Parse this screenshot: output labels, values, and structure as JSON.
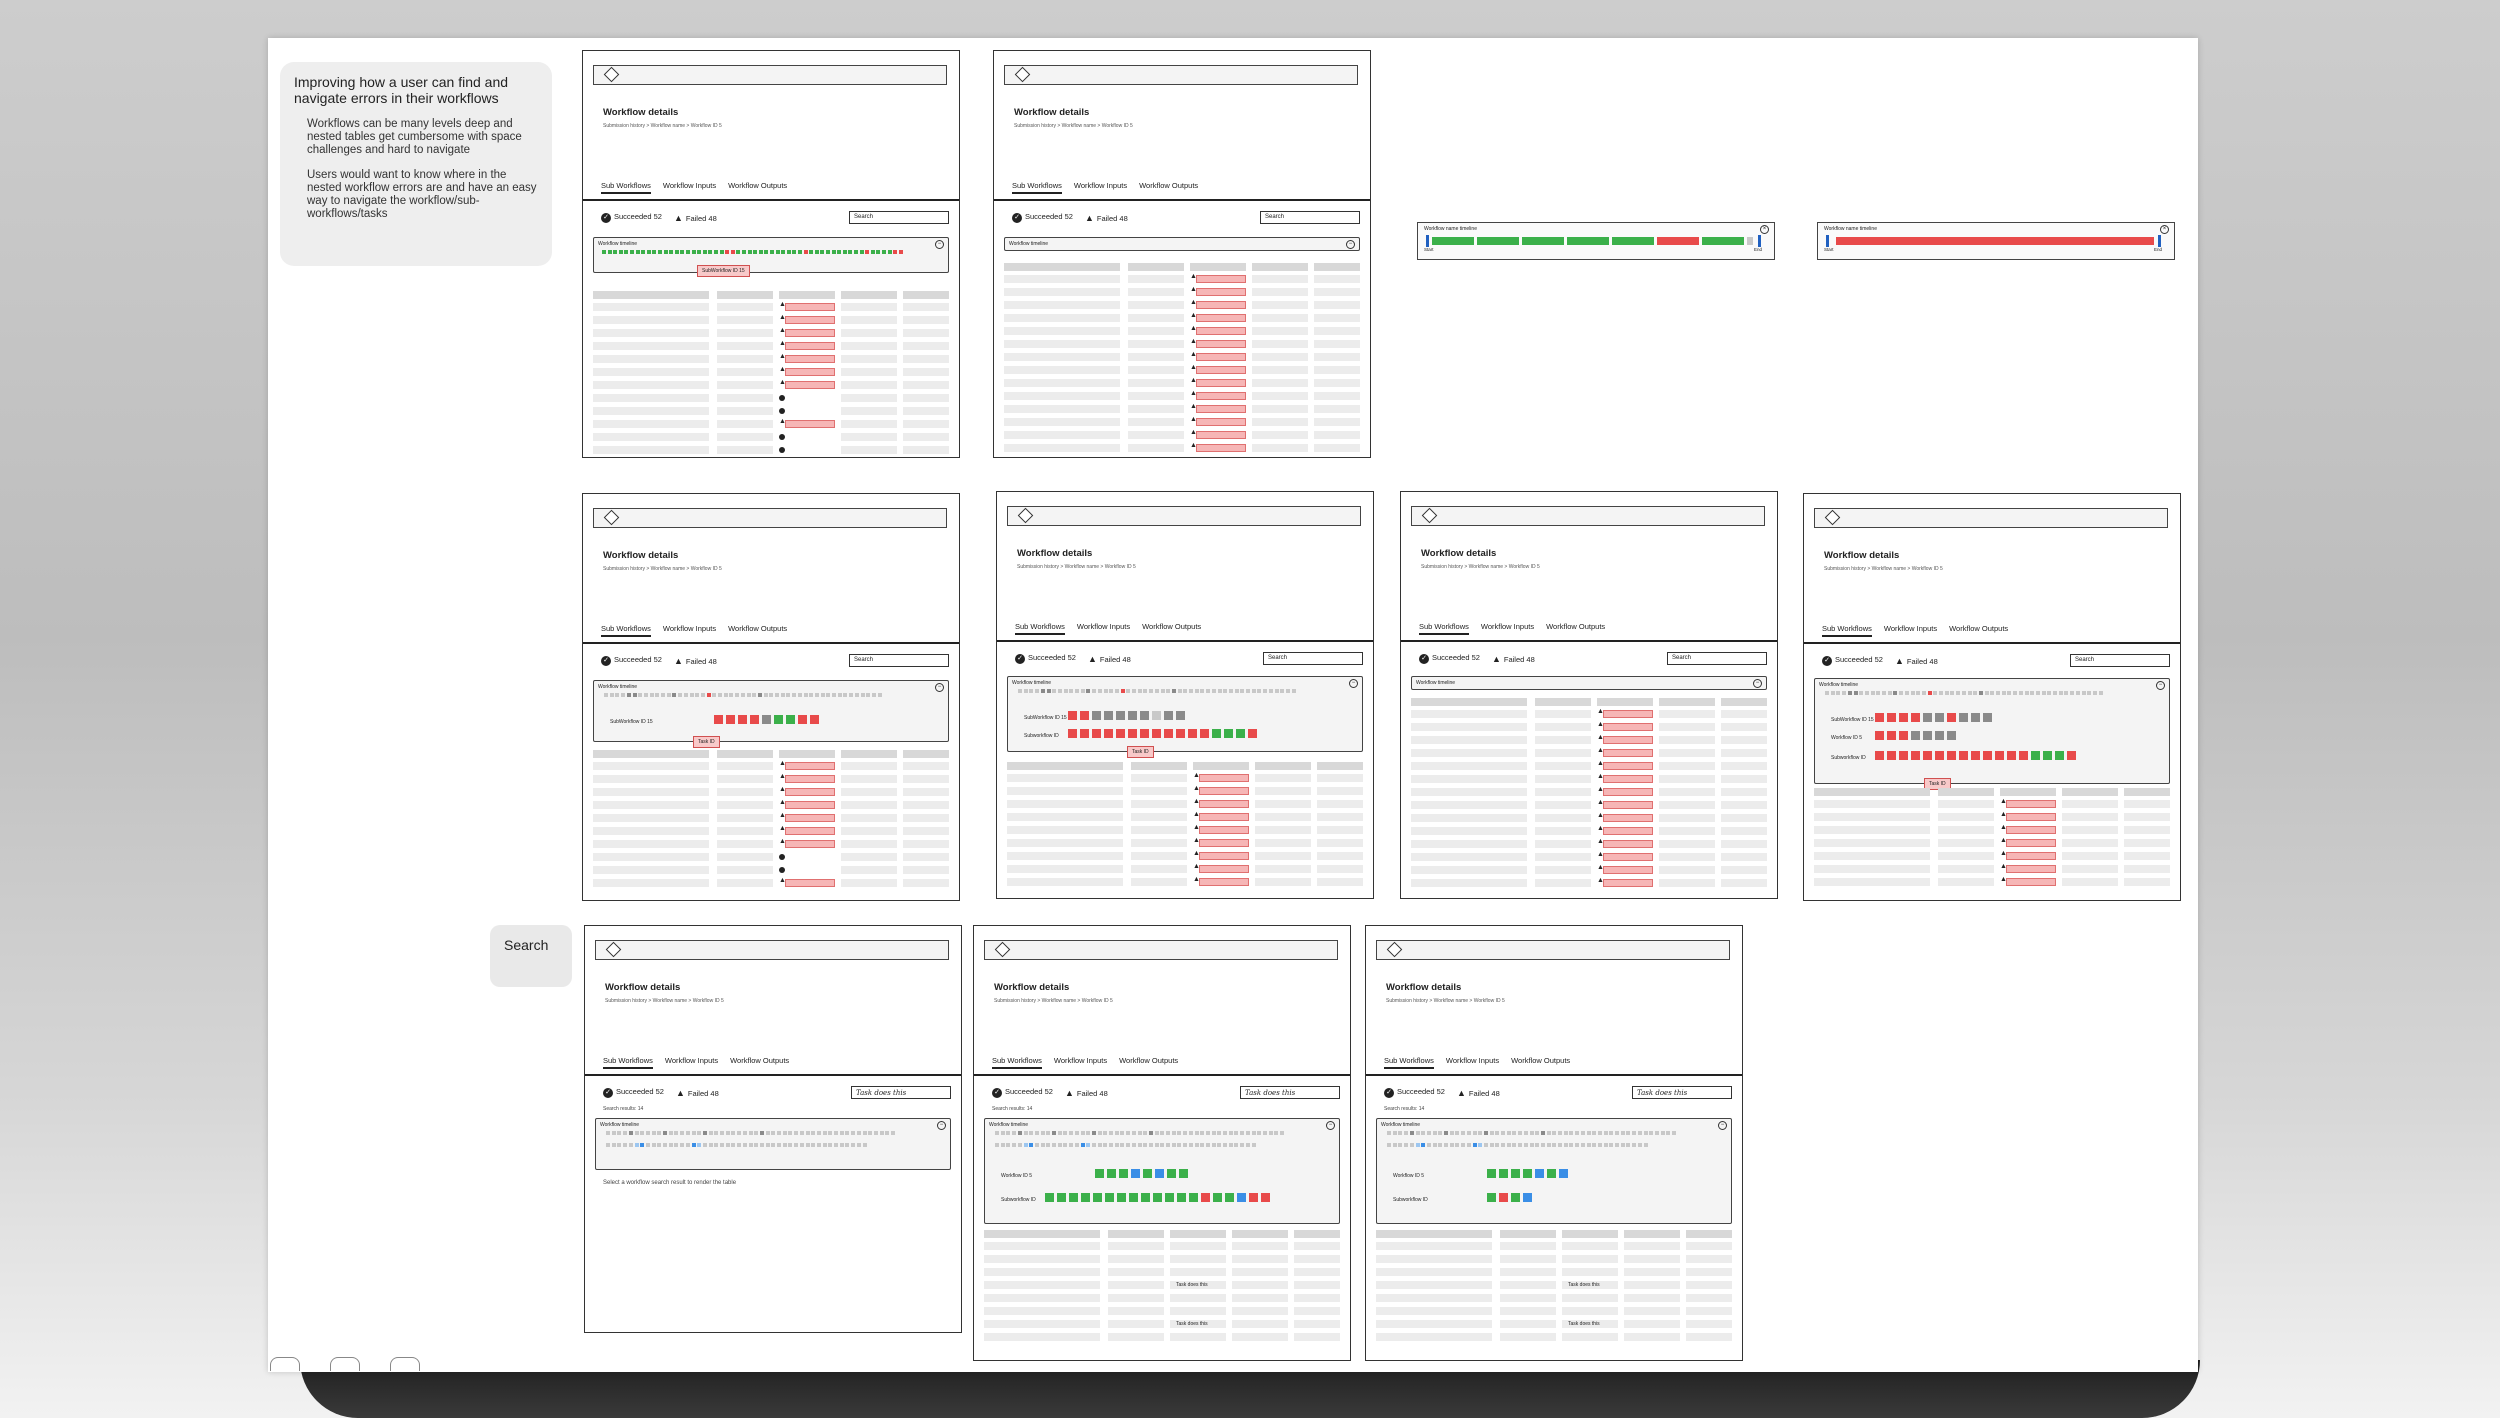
{
  "notes": {
    "intro_title": "Improving how a user can find and navigate errors in their workflows",
    "point1": "Workflows can be many levels deep and nested tables get cumbersome with space challenges and hard to navigate",
    "point2": "Users would want to know where in the nested workflow errors are and have an easy way to navigate the workflow/sub-workflows/tasks",
    "search_label": "Search"
  },
  "common": {
    "title": "Workflow details",
    "breadcrumb": "Submission history > Workflow name > Workflow ID 5",
    "tab_sub": "Sub Workflows",
    "tab_inputs": "Workflow Inputs",
    "tab_outputs": "Workflow Outputs",
    "succeeded": "Succeeded 52",
    "failed": "Failed 48",
    "search_placeholder": "Search",
    "timeline_label": "Workflow timeline",
    "timeline_name_label": "Workflow name timeline",
    "search_query": "Task does this",
    "search_results": "Search results: 14",
    "select_msg": "Select a workflow search result to render the table",
    "subworkflow_tip": "SubWorkflow ID 15",
    "task_tip": "Task ID",
    "start": "Start",
    "end": "End",
    "subworkflow_id": "SubWorkflow ID 15",
    "workflow_id": "Workflow ID 5",
    "subworkflow_label": "Subworkflow ID",
    "table_match": "Task does this"
  },
  "colors": {
    "success": "#3bb04a",
    "error": "#e84a4a",
    "neutral": "#c8c8c8",
    "highlight": "#3a8ee6"
  }
}
